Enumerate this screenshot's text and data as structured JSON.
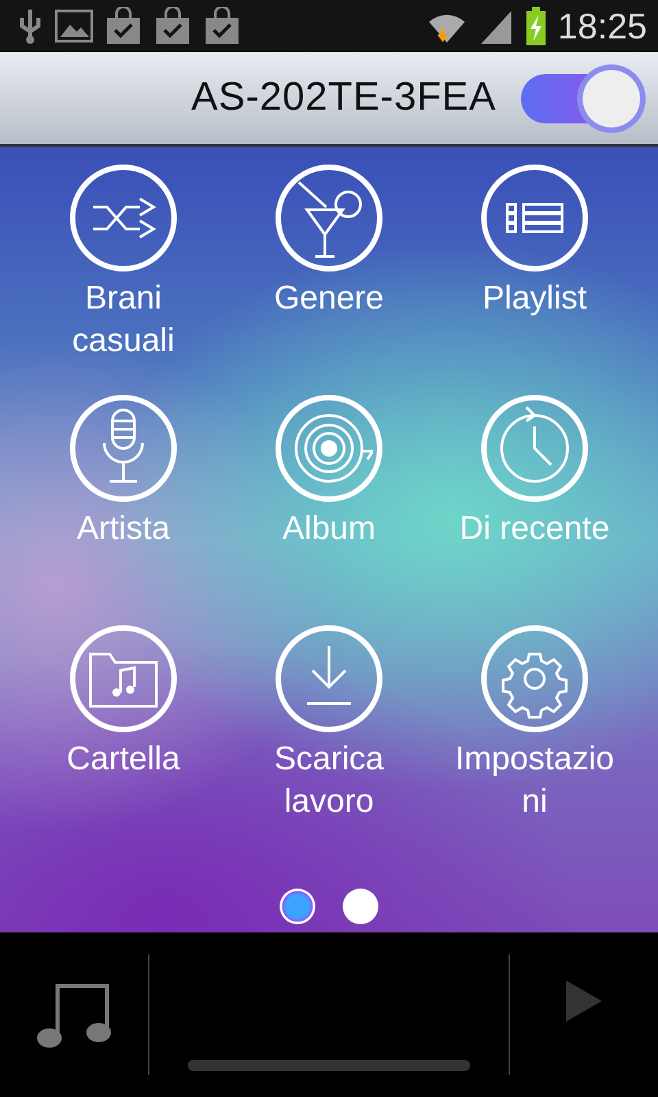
{
  "status_bar": {
    "time": "18:25"
  },
  "header": {
    "title": "AS-202TE-3FEA",
    "toggle_on": true
  },
  "menu": [
    {
      "label": "Brani casuali",
      "kind": "shuffle"
    },
    {
      "label": "Genere",
      "kind": "cocktail"
    },
    {
      "label": "Playlist",
      "kind": "list"
    },
    {
      "label": "Artista",
      "kind": "microphone"
    },
    {
      "label": "Album",
      "kind": "disc"
    },
    {
      "label": "Di recente",
      "kind": "clock"
    },
    {
      "label": "Cartella",
      "kind": "folder"
    },
    {
      "label": "Scarica lavoro",
      "kind": "download"
    },
    {
      "label": "Impostazioni",
      "kind": "gear"
    }
  ],
  "pages": [
    {
      "selected": true
    },
    {
      "selected": false
    }
  ],
  "player": {
    "play_disabled": true
  }
}
